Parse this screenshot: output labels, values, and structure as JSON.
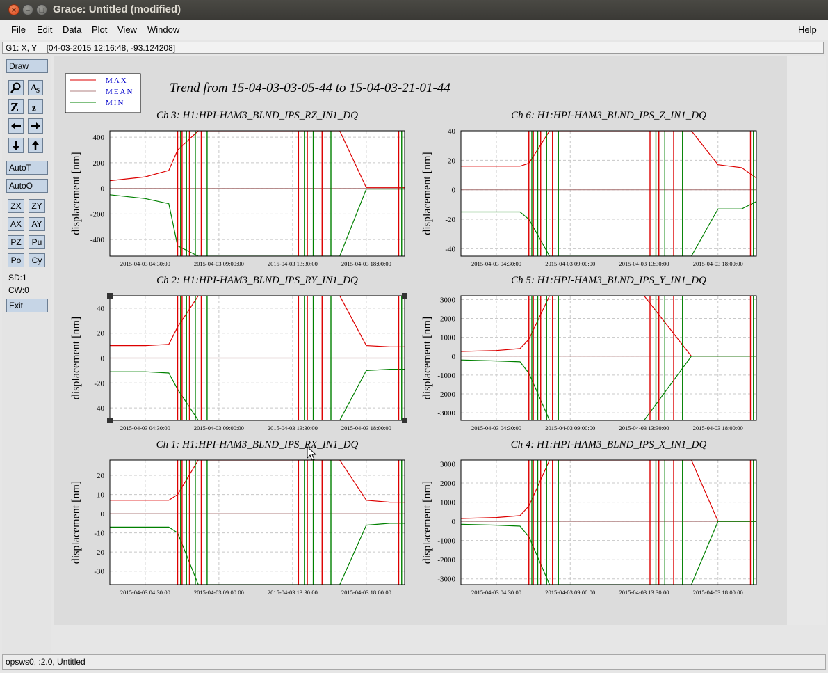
{
  "window": {
    "title": "Grace: Untitled (modified)"
  },
  "menubar": {
    "items": [
      "File",
      "Edit",
      "Data",
      "Plot",
      "View",
      "Window"
    ],
    "help": "Help"
  },
  "locator": {
    "text": "G1: X, Y = [04-03-2015 12:16:48, -93.124208]"
  },
  "toolbar": {
    "draw": "Draw",
    "auto_t": "AutoT",
    "auto_o": "AutoO",
    "zx": "ZX",
    "zy": "ZY",
    "ax": "AX",
    "ay": "AY",
    "pz": "PZ",
    "pu": "Pu",
    "po": "Po",
    "cy": "Cy",
    "sd": "SD:1",
    "cw": "CW:0",
    "exit": "Exit",
    "icons": [
      "zoom-icon",
      "autoscale-text-icon",
      "zoom-in-icon",
      "zoom-out-icon",
      "scroll-left-icon",
      "scroll-right-icon",
      "scroll-down-icon",
      "scroll-up-icon"
    ]
  },
  "status": {
    "text": "opsws0, :2.0, Untitled"
  },
  "plot": {
    "title": "Trend from 15-04-03-03-05-44 to 15-04-03-21-01-44",
    "legend": [
      {
        "label": "MAX",
        "color": "#dd0000"
      },
      {
        "label": "MEAN",
        "color": "#b08080"
      },
      {
        "label": "MIN",
        "color": "#008000"
      }
    ],
    "colors": {
      "max": "#dd0000",
      "mean": "#b08080",
      "min": "#008000",
      "grid": "#c8c8c8"
    }
  },
  "chart_data": [
    {
      "type": "line",
      "title": "Ch 3: H1:HPI-HAM3_BLND_IPS_RZ_IN1_DQ",
      "ylabel": "displacement [nm]",
      "yticks": [
        "400",
        "200",
        "0",
        "-200",
        "-400"
      ],
      "ylim": [
        -530,
        450
      ],
      "xticks": [
        "2015-04-03 04:30:00",
        "2015-04-03 09:00:00",
        "2015-04-03 13:30:00",
        "2015-04-03 18:00:00"
      ],
      "x": [
        "03:05",
        "04:30",
        "06:00",
        "07:00",
        "09:00",
        "13:30",
        "16:00",
        "18:00",
        "20:00",
        "21:00"
      ],
      "series": [
        {
          "name": "MAX",
          "values": [
            60,
            90,
            140,
            300,
            450,
            450,
            450,
            5,
            5,
            5
          ]
        },
        {
          "name": "MEAN",
          "values": [
            0,
            0,
            0,
            0,
            0,
            0,
            0,
            0,
            0,
            0
          ]
        },
        {
          "name": "MIN",
          "values": [
            -50,
            -80,
            -120,
            -450,
            -530,
            -530,
            -530,
            -5,
            -5,
            -5
          ]
        }
      ]
    },
    {
      "type": "line",
      "title": "Ch 6: H1:HPI-HAM3_BLND_IPS_Z_IN1_DQ",
      "ylabel": "displacement [nm]",
      "yticks": [
        "40",
        "20",
        "0",
        "-20",
        "-40"
      ],
      "ylim": [
        -45,
        40
      ],
      "xticks": [
        "2015-04-03 04:30:00",
        "2015-04-03 09:00:00",
        "2015-04-03 13:30:00",
        "2015-04-03 18:00:00"
      ],
      "x": [
        "03:05",
        "04:30",
        "06:00",
        "07:00",
        "09:00",
        "13:30",
        "16:00",
        "18:00",
        "20:00",
        "21:00"
      ],
      "series": [
        {
          "name": "MAX",
          "values": [
            16,
            16,
            16,
            18,
            40,
            40,
            40,
            17,
            15,
            8
          ]
        },
        {
          "name": "MEAN",
          "values": [
            0,
            0,
            0,
            0,
            0,
            0,
            0,
            0,
            0,
            0
          ]
        },
        {
          "name": "MIN",
          "values": [
            -15,
            -15,
            -15,
            -20,
            -45,
            -45,
            -45,
            -13,
            -13,
            -8
          ]
        }
      ]
    },
    {
      "type": "line",
      "title": "Ch 2: H1:HPI-HAM3_BLND_IPS_RY_IN1_DQ",
      "ylabel": "displacement [nm]",
      "yticks": [
        "40",
        "20",
        "0",
        "-20",
        "-40"
      ],
      "ylim": [
        -50,
        50
      ],
      "xticks": [
        "2015-04-03 04:30:00",
        "2015-04-03 09:00:00",
        "2015-04-03 13:30:00",
        "2015-04-03 18:00:00"
      ],
      "x": [
        "03:05",
        "04:30",
        "06:00",
        "07:00",
        "09:00",
        "13:30",
        "16:00",
        "18:00",
        "20:00",
        "21:00"
      ],
      "series": [
        {
          "name": "MAX",
          "values": [
            10,
            10,
            11,
            25,
            50,
            50,
            50,
            10,
            9,
            9
          ]
        },
        {
          "name": "MEAN",
          "values": [
            0,
            0,
            0,
            0,
            0,
            0,
            0,
            0,
            0,
            0
          ]
        },
        {
          "name": "MIN",
          "values": [
            -11,
            -11,
            -12,
            -25,
            -50,
            -50,
            -50,
            -10,
            -9,
            -9
          ]
        }
      ]
    },
    {
      "type": "line",
      "title": "Ch 5: H1:HPI-HAM3_BLND_IPS_Y_IN1_DQ",
      "ylabel": "displacement [nm]",
      "yticks": [
        "3000",
        "2000",
        "1000",
        "0",
        "-1000",
        "-2000",
        "-3000"
      ],
      "ylim": [
        -3400,
        3200
      ],
      "xticks": [
        "2015-04-03 04:30:00",
        "2015-04-03 09:00:00",
        "2015-04-03 13:30:00",
        "2015-04-03 18:00:00"
      ],
      "x": [
        "03:05",
        "04:30",
        "06:00",
        "07:00",
        "09:00",
        "13:30",
        "16:00",
        "18:00",
        "20:00",
        "21:00"
      ],
      "series": [
        {
          "name": "MAX",
          "values": [
            250,
            300,
            400,
            900,
            3200,
            3200,
            0,
            0,
            0,
            0
          ]
        },
        {
          "name": "MEAN",
          "values": [
            0,
            0,
            0,
            0,
            0,
            0,
            0,
            0,
            0,
            0
          ]
        },
        {
          "name": "MIN",
          "values": [
            -200,
            -250,
            -300,
            -900,
            -3400,
            -3400,
            0,
            0,
            0,
            0
          ]
        }
      ]
    },
    {
      "type": "line",
      "title": "Ch 1: H1:HPI-HAM3_BLND_IPS_RX_IN1_DQ",
      "ylabel": "displacement [nm]",
      "yticks": [
        "20",
        "10",
        "0",
        "-10",
        "-20",
        "-30"
      ],
      "ylim": [
        -37,
        28
      ],
      "xticks": [
        "2015-04-03 04:30:00",
        "2015-04-03 09:00:00",
        "2015-04-03 13:30:00",
        "2015-04-03 18:00:00"
      ],
      "x": [
        "03:05",
        "04:30",
        "06:00",
        "07:00",
        "09:00",
        "13:30",
        "16:00",
        "18:00",
        "20:00",
        "21:00"
      ],
      "series": [
        {
          "name": "MAX",
          "values": [
            7,
            7,
            7,
            10,
            28,
            28,
            28,
            7,
            6,
            6
          ]
        },
        {
          "name": "MEAN",
          "values": [
            0,
            0,
            0,
            0,
            0,
            0,
            0,
            0,
            0,
            0
          ]
        },
        {
          "name": "MIN",
          "values": [
            -7,
            -7,
            -7,
            -10,
            -37,
            -37,
            -37,
            -6,
            -5,
            -5
          ]
        }
      ]
    },
    {
      "type": "line",
      "title": "Ch 4: H1:HPI-HAM3_BLND_IPS_X_IN1_DQ",
      "ylabel": "displacement [nm]",
      "yticks": [
        "3000",
        "2000",
        "1000",
        "0",
        "-1000",
        "-2000",
        "-3000"
      ],
      "ylim": [
        -3300,
        3200
      ],
      "xticks": [
        "2015-04-03 04:30:00",
        "2015-04-03 09:00:00",
        "2015-04-03 13:30:00",
        "2015-04-03 18:00:00"
      ],
      "x": [
        "03:05",
        "04:30",
        "06:00",
        "07:00",
        "09:00",
        "13:30",
        "16:00",
        "18:00",
        "20:00",
        "21:00"
      ],
      "series": [
        {
          "name": "MAX",
          "values": [
            150,
            200,
            300,
            800,
            3200,
            3200,
            3200,
            0,
            0,
            0
          ]
        },
        {
          "name": "MEAN",
          "values": [
            0,
            0,
            0,
            0,
            0,
            0,
            0,
            0,
            0,
            0
          ]
        },
        {
          "name": "MIN",
          "values": [
            -150,
            -200,
            -250,
            -800,
            -3300,
            -3300,
            -3300,
            0,
            0,
            0
          ]
        }
      ]
    }
  ]
}
